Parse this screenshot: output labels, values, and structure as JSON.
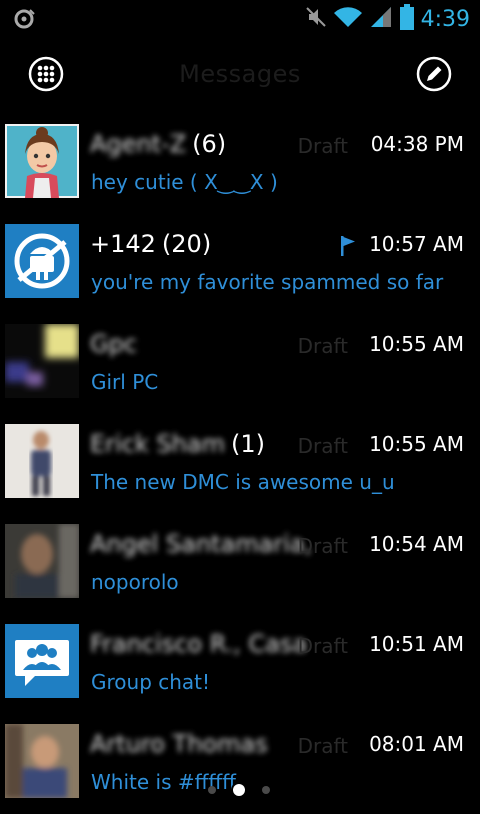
{
  "status_bar": {
    "time": "4:39",
    "left_icon": "debug-icon",
    "icons": [
      "mute-icon",
      "wifi-icon",
      "signal-icon",
      "battery-icon"
    ]
  },
  "action_bar": {
    "title": "Messages",
    "left_button_icon": "apps-grid-icon",
    "right_button_icon": "compose-icon"
  },
  "conversations": [
    {
      "name": "Agent-Z",
      "name_blurred": true,
      "count": "(6)",
      "draft": "Draft",
      "time": "04:38 PM",
      "preview": "hey cutie ( X‿‿X )",
      "flagged": false
    },
    {
      "name": "+142",
      "name_blurred": false,
      "count": "(20)",
      "draft": "",
      "time": "10:57 AM",
      "preview": "you're my favorite spammed so far",
      "flagged": true
    },
    {
      "name": "Gpc",
      "name_blurred": true,
      "count": "",
      "draft": "Draft",
      "time": "10:55 AM",
      "preview": "Girl PC",
      "flagged": false
    },
    {
      "name": "Erick Sham",
      "name_blurred": true,
      "count": "(1)",
      "draft": "Draft",
      "time": "10:55 AM",
      "preview": "The new DMC is awesome u_u",
      "flagged": false
    },
    {
      "name": "Angel Santamaria,",
      "name_blurred": true,
      "count": "",
      "draft": "Draft",
      "time": "10:54 AM",
      "preview": "noporolo",
      "flagged": false
    },
    {
      "name": "Francisco R., Casa",
      "name_blurred": true,
      "count": "",
      "draft": "Draft",
      "time": "10:51 AM",
      "preview": "Group chat!",
      "flagged": false
    },
    {
      "name": "Arturo Thomas",
      "name_blurred": true,
      "count": "",
      "draft": "Draft",
      "time": "08:01 AM",
      "preview": "White is #ffffff",
      "flagged": false
    }
  ],
  "pager": {
    "pages": 3,
    "active": 2
  },
  "colors": {
    "accent": "#33b5e5",
    "preview_text": "#2f8fd8",
    "background": "#000000"
  }
}
